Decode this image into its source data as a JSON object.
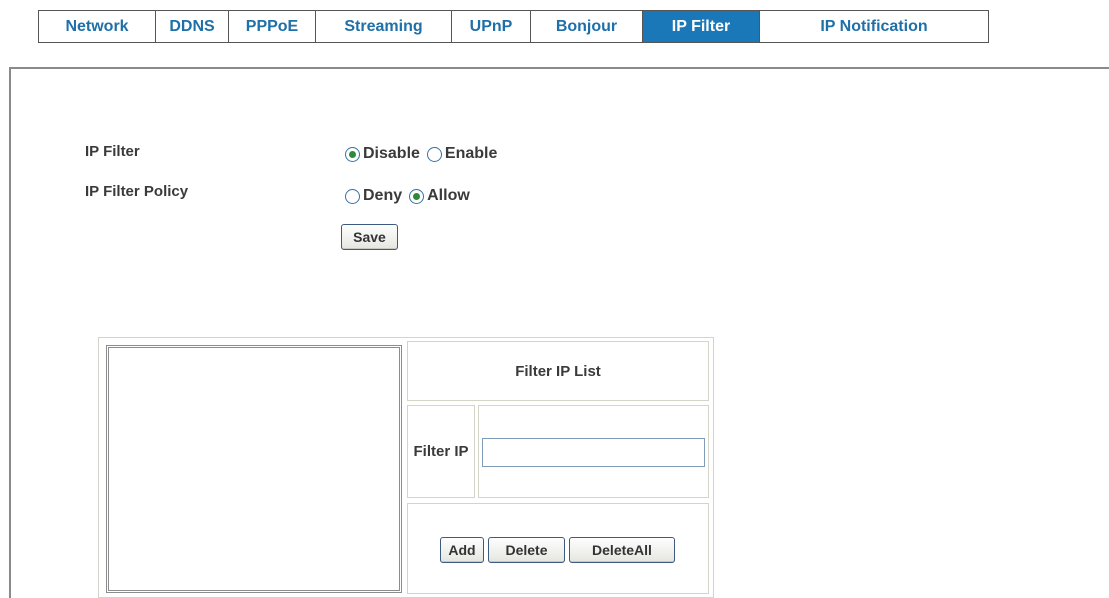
{
  "tabs": [
    {
      "label": "Network",
      "active": false
    },
    {
      "label": "DDNS",
      "active": false
    },
    {
      "label": "PPPoE",
      "active": false
    },
    {
      "label": "Streaming",
      "active": false
    },
    {
      "label": "UPnP",
      "active": false
    },
    {
      "label": "Bonjour",
      "active": false
    },
    {
      "label": "IP Filter",
      "active": true
    },
    {
      "label": "IP Notification",
      "active": false
    }
  ],
  "ip_filter": {
    "label": "IP Filter",
    "options": [
      {
        "label": "Disable",
        "checked": true
      },
      {
        "label": "Enable",
        "checked": false
      }
    ]
  },
  "ip_filter_policy": {
    "label": "IP Filter Policy",
    "options": [
      {
        "label": "Deny",
        "checked": false
      },
      {
        "label": "Allow",
        "checked": true
      }
    ]
  },
  "save_button": "Save",
  "filter_list": {
    "title": "Filter IP List",
    "filter_ip_label": "Filter IP",
    "filter_ip_value": "",
    "add_button": "Add",
    "delete_button": "Delete",
    "delete_all_button": "DeleteAll"
  },
  "colors": {
    "tab_text": "#1f6fa8",
    "tab_active_bg": "#1a78b9",
    "radio_dot": "#2e8b3c"
  }
}
